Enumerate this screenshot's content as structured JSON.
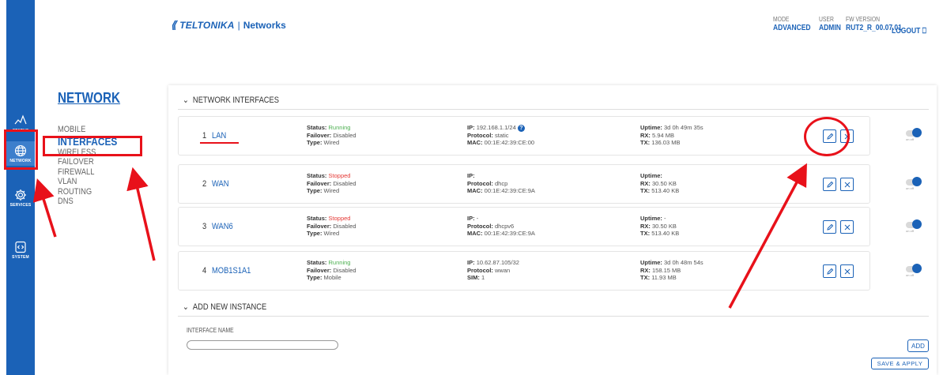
{
  "rail": [
    {
      "label": "STATUS",
      "icon": "status-pulse-icon",
      "active": false
    },
    {
      "label": "NETWORK",
      "icon": "globe-icon",
      "active": true
    },
    {
      "label": "SERVICES",
      "icon": "gear-icon",
      "active": false
    },
    {
      "label": "SYSTEM",
      "icon": "system-code-icon",
      "active": false
    }
  ],
  "subnav": {
    "title": "NETWORK",
    "items": [
      "MOBILE",
      "INTERFACES",
      "WIRELESS",
      "FAILOVER",
      "FIREWALL",
      "VLAN",
      "ROUTING",
      "DNS"
    ],
    "active": "INTERFACES"
  },
  "header": {
    "logo_text": "TELTONIKA",
    "logo_sep": "|",
    "logo_sub": "Networks",
    "mode_label": "MODE",
    "mode_value": "ADVANCED",
    "user_label": "USER",
    "user_value": "ADMIN",
    "fw_label": "FW VERSION",
    "fw_value": "RUT2_R_00.07.01",
    "logout": "LOGOUT"
  },
  "interfaces_section": {
    "title": "NETWORK INTERFACES"
  },
  "interfaces": [
    {
      "num": "1",
      "name": "LAN",
      "status_label": "Status:",
      "status": "Running",
      "status_kind": "running",
      "failover_label": "Failover:",
      "failover": "Disabled",
      "type_label": "Type:",
      "type": "Wired",
      "ip_label": "IP:",
      "ip": "192.168.1.1/24",
      "protocol_label": "Protocol:",
      "protocol": "static",
      "third_label": "MAC:",
      "third": "00:1E:42:39:CE:00",
      "uptime_label": "Uptime:",
      "uptime": "3d 0h 49m 35s",
      "rx_label": "RX:",
      "rx": "5.94 MB",
      "tx_label": "TX:",
      "tx": "136.03 MB",
      "enabled_text": "on off"
    },
    {
      "num": "2",
      "name": "WAN",
      "status_label": "Status:",
      "status": "Stopped",
      "status_kind": "stopped",
      "failover_label": "Failover:",
      "failover": "Disabled",
      "type_label": "Type:",
      "type": "Wired",
      "ip_label": "IP:",
      "ip": "",
      "protocol_label": "Protocol:",
      "protocol": "dhcp",
      "third_label": "MAC:",
      "third": "00:1E:42:39:CE:9A",
      "uptime_label": "Uptime:",
      "uptime": "",
      "rx_label": "RX:",
      "rx": "30.50 KB",
      "tx_label": "TX:",
      "tx": "513.40 KB",
      "enabled_text": "on off"
    },
    {
      "num": "3",
      "name": "WAN6",
      "status_label": "Status:",
      "status": "Stopped",
      "status_kind": "stopped",
      "failover_label": "Failover:",
      "failover": "Disabled",
      "type_label": "Type:",
      "type": "Wired",
      "ip_label": "IP:",
      "ip": "-",
      "protocol_label": "Protocol:",
      "protocol": "dhcpv6",
      "third_label": "MAC:",
      "third": "00:1E:42:39:CE:9A",
      "uptime_label": "Uptime:",
      "uptime": "-",
      "rx_label": "RX:",
      "rx": "30.50 KB",
      "tx_label": "TX:",
      "tx": "513.40 KB",
      "enabled_text": "on off"
    },
    {
      "num": "4",
      "name": "MOB1S1A1",
      "status_label": "Status:",
      "status": "Running",
      "status_kind": "running",
      "failover_label": "Failover:",
      "failover": "Disabled",
      "type_label": "Type:",
      "type": "Mobile",
      "ip_label": "IP:",
      "ip": "10.62.87.105/32",
      "protocol_label": "Protocol:",
      "protocol": "wwan",
      "third_label": "SIM:",
      "third": "1",
      "uptime_label": "Uptime:",
      "uptime": "3d 0h 48m 54s",
      "rx_label": "RX:",
      "rx": "158.15 MB",
      "tx_label": "TX:",
      "tx": "11.93 MB",
      "enabled_text": "on off"
    }
  ],
  "add_section": {
    "title": "ADD NEW INSTANCE",
    "field_label": "INTERFACE NAME",
    "field_value": "",
    "add_button": "ADD",
    "save_button": "SAVE & APPLY"
  },
  "colors": {
    "brand": "#1b62b7",
    "running": "#4caf50",
    "stopped": "#e53935",
    "annotation": "#e8111a"
  }
}
